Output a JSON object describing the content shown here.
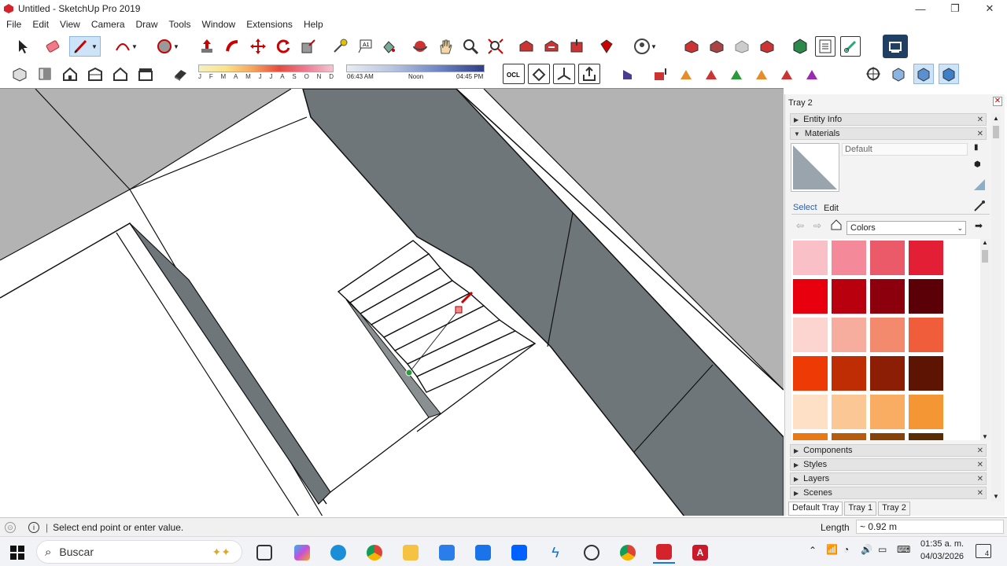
{
  "window": {
    "title": "Untitled - SketchUp Pro 2019",
    "min": "—",
    "restore": "❐",
    "close": "✕"
  },
  "menu": [
    "File",
    "Edit",
    "View",
    "Camera",
    "Draw",
    "Tools",
    "Window",
    "Extensions",
    "Help"
  ],
  "shadow": {
    "months": [
      "J",
      "F",
      "M",
      "A",
      "M",
      "J",
      "J",
      "A",
      "S",
      "O",
      "N",
      "D"
    ],
    "time_start": "06:43 AM",
    "time_noon": "Noon",
    "time_end": "04:45 PM"
  },
  "tray": {
    "title": "Tray 2",
    "panels": {
      "entity_info": "Entity Info",
      "materials": "Materials",
      "components": "Components",
      "styles": "Styles",
      "layers": "Layers",
      "scenes": "Scenes"
    },
    "material_name": "Default",
    "tabs": {
      "select": "Select",
      "edit": "Edit"
    },
    "library": "Colors",
    "bottom_tabs": [
      "Default Tray",
      "Tray 1",
      "Tray 2"
    ],
    "swatch_colors": [
      "#f9c0c7",
      "#f48a99",
      "#ea5a68",
      "#e31f35",
      "#e8000e",
      "#b8000e",
      "#8c000d",
      "#5c0008",
      "#fcd4d0",
      "#f7ad9e",
      "#f3896d",
      "#f05d3b",
      "#ee3a05",
      "#bf2d05",
      "#8b1e05",
      "#5d1403",
      "#fde0c6",
      "#fbc795",
      "#f8ad63",
      "#f59634",
      "#e77a14",
      "#b55c0d",
      "#864309",
      "#5a2c06"
    ]
  },
  "status": {
    "message": "Select end point or enter value.",
    "measure_label": "Length",
    "measure_value": "~ 0.92 m"
  },
  "taskbar": {
    "search": "Buscar",
    "time": "01:35 a. m.",
    "date": "04/03/2026",
    "notif": "4"
  },
  "colors": {
    "accent": "#d4232a",
    "wall_gray": "#6f767a",
    "ground_gray": "#b3b3b3"
  }
}
